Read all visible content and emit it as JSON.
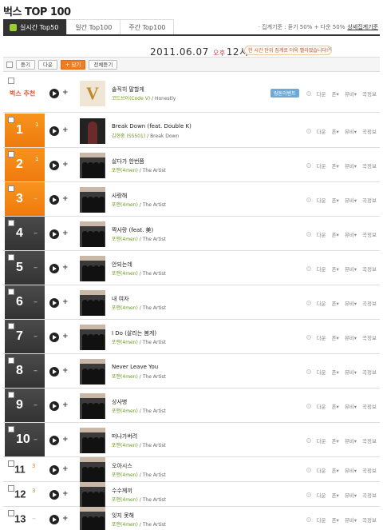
{
  "page": {
    "title": "벅스 TOP 100"
  },
  "tabs": [
    {
      "label": "실시간 Top50",
      "active": true
    },
    {
      "label": "일간 Top100",
      "active": false
    },
    {
      "label": "주간 Top100",
      "active": false
    }
  ],
  "criteria": {
    "text": "· 집계기준 : 듣기 50% + 다운 50%",
    "link": "상세집계기준"
  },
  "header": {
    "date": "2011.06.07",
    "ampm": "오후",
    "hour": "12시",
    "notice": "한 시간 단위 집계로 더욱 빨라졌습니다!"
  },
  "controls": {
    "listen": "듣기",
    "download": "다운",
    "add": "+ 담기",
    "all_listen": "전체듣기"
  },
  "recommend": {
    "label": "벅스 추천",
    "song": "솔직히 말할게",
    "artist": "코드브이(Code V)",
    "album": "Honestly",
    "ring": "링톤이벤트"
  },
  "actions": {
    "download": "다운",
    "ring": "폰",
    "music_video": "뮤비",
    "info": "곡정보",
    "caret": "▾"
  },
  "chart_rows": [
    {
      "rank": "1",
      "trend": "1",
      "song": "Break Down (feat. Double K)",
      "artist": "김현중 (SS501)",
      "album": "Break Down"
    },
    {
      "rank": "2",
      "trend": "1",
      "song": "살다가 한번쯤",
      "artist": "포맨(4men)",
      "album": "The Artist"
    },
    {
      "rank": "3",
      "trend": "–",
      "song": "사랑해",
      "artist": "포맨(4men)",
      "album": "The Artist"
    },
    {
      "rank": "4",
      "trend": "–",
      "song": "짝사랑 (feat. 美)",
      "artist": "포맨(4men)",
      "album": "The Artist"
    },
    {
      "rank": "5",
      "trend": "–",
      "song": "안되는데",
      "artist": "포맨(4men)",
      "album": "The Artist"
    },
    {
      "rank": "6",
      "trend": "–",
      "song": "내 여자",
      "artist": "포맨(4men)",
      "album": "The Artist"
    },
    {
      "rank": "7",
      "trend": "–",
      "song": "I Do (살리는 봄게)",
      "artist": "포맨(4men)",
      "album": "The Artist"
    },
    {
      "rank": "8",
      "trend": "–",
      "song": "Never Leave You",
      "artist": "포맨(4men)",
      "album": "The Artist"
    },
    {
      "rank": "9",
      "trend": "–",
      "song": "상사병",
      "artist": "포맨(4men)",
      "album": "The Artist"
    },
    {
      "rank": "10",
      "trend": "–",
      "song": "떠나가버려",
      "artist": "포맨(4men)",
      "album": "The Artist"
    },
    {
      "rank": "11",
      "trend": "3",
      "song": "오아시스",
      "artist": "포맨(4men)",
      "album": "The Artist"
    },
    {
      "rank": "12",
      "trend": "3",
      "song": "수수께끼",
      "artist": "포맨(4men)",
      "album": "The Artist"
    },
    {
      "rank": "13",
      "trend": "–",
      "song": "잊지 못해",
      "artist": "포맨(4men)",
      "album": "The Artist"
    }
  ]
}
